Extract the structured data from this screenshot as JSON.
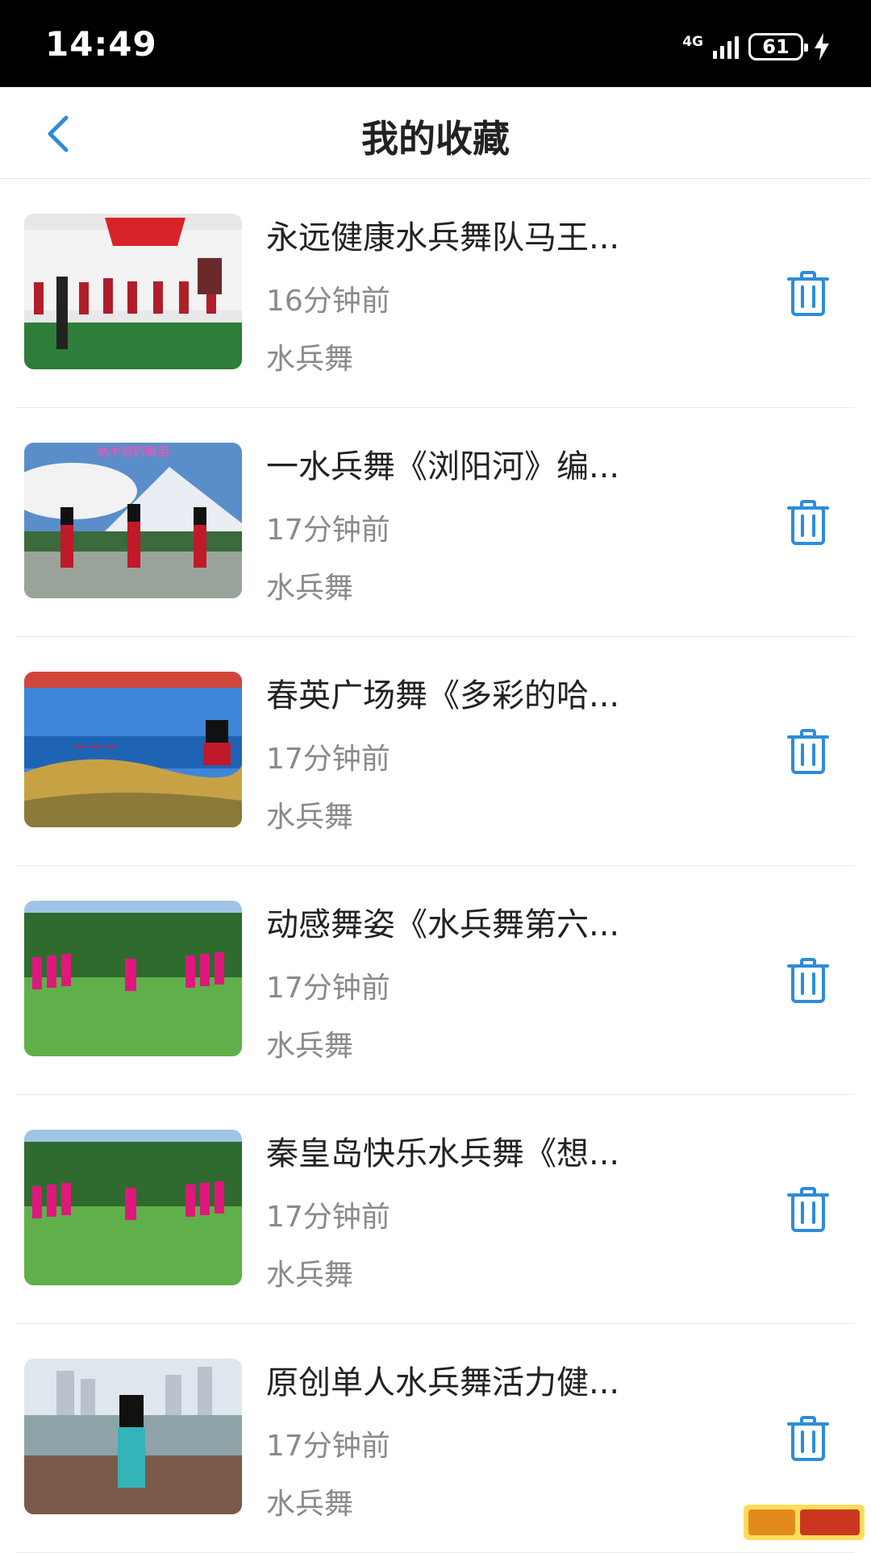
{
  "status_bar": {
    "time": "14:49",
    "network": "4G",
    "battery": "61"
  },
  "header": {
    "title": "我的收藏"
  },
  "favorites": [
    {
      "title": "永远健康水兵舞队马王...",
      "time": "16分钟前",
      "category": "水兵舞"
    },
    {
      "title": "一水兵舞《浏阳河》编...",
      "time": "17分钟前",
      "category": "水兵舞"
    },
    {
      "title": "春英广场舞《多彩的哈...",
      "time": "17分钟前",
      "category": "水兵舞"
    },
    {
      "title": "动感舞姿《水兵舞第六...",
      "time": "17分钟前",
      "category": "水兵舞"
    },
    {
      "title": "秦皇岛快乐水兵舞《想...",
      "time": "17分钟前",
      "category": "水兵舞"
    },
    {
      "title": "原创单人水兵舞活力健...",
      "time": "17分钟前",
      "category": "水兵舞"
    }
  ],
  "thumbnail_text": {
    "item2": "纳木错的眼泪"
  },
  "colors": {
    "accent": "#2d8cd9",
    "title_text": "#222222",
    "secondary_text": "#8a8a8a"
  },
  "icons": {
    "back": "chevron-left-icon",
    "delete": "trash-icon"
  }
}
